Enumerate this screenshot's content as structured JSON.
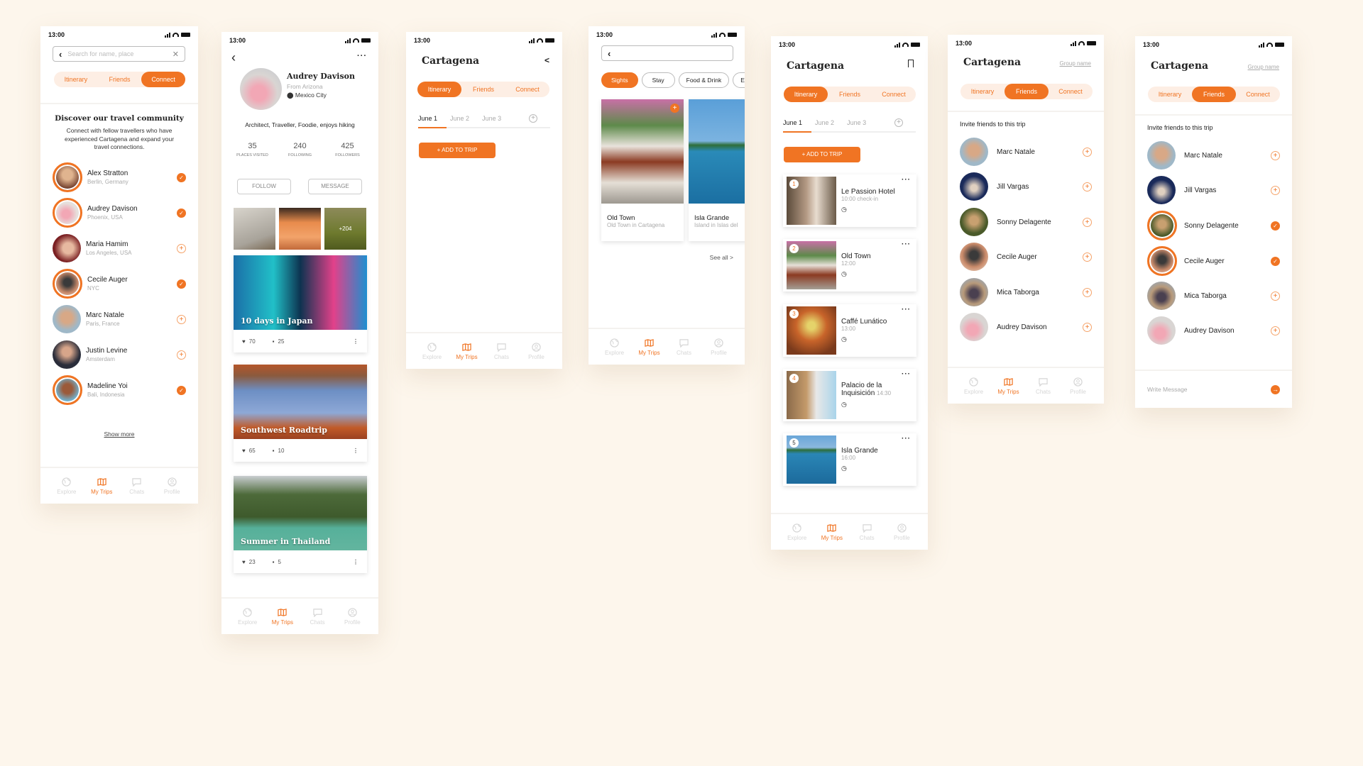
{
  "status": {
    "time": "13:00"
  },
  "colors": {
    "accent": "#f07423",
    "accent_light": "#fdeee4",
    "background": "#fdf6ec"
  },
  "nav": [
    {
      "label": "Explore",
      "icon": "globe-icon"
    },
    {
      "label": "My Trips",
      "icon": "map-icon",
      "active": true
    },
    {
      "label": "Chats",
      "icon": "chat-icon"
    },
    {
      "label": "Profile",
      "icon": "profile-icon"
    }
  ],
  "tabs": [
    "Itinerary",
    "Friends",
    "Connect"
  ],
  "connect": {
    "search_placeholder": "Search for name, place",
    "active_tab": "Connect",
    "heading": "Discover our travel community",
    "description": "Connect with fellow travellers who have experienced Cartagena and expand your travel connections.",
    "people": [
      {
        "name": "Alex Stratton",
        "location": "Berlin, Germany",
        "selected": true
      },
      {
        "name": "Audrey Davison",
        "location": "Phoenix, USA",
        "selected": true
      },
      {
        "name": "Maria Hamim",
        "location": "Los Angeles, USA",
        "selected": false
      },
      {
        "name": "Cecile Auger",
        "location": "NYC",
        "selected": true
      },
      {
        "name": "Marc Natale",
        "location": "Paris, France",
        "selected": false
      },
      {
        "name": "Justin Levine",
        "location": "Amsterdam",
        "selected": false
      },
      {
        "name": "Madeline Yoi",
        "location": "Bali, Indonesia",
        "selected": true
      }
    ],
    "show_more": "Show more"
  },
  "profile": {
    "name": "Audrey Davison",
    "from": "From Arizona",
    "city": "Mexico City",
    "bio": "Architect, Traveller, Foodie, enjoys hiking",
    "stats": [
      {
        "value": "35",
        "label": "PLACES VISITED"
      },
      {
        "value": "240",
        "label": "FOLLOWING"
      },
      {
        "value": "425",
        "label": "FOLLOWERS"
      }
    ],
    "follow": "FOLLOW",
    "message": "MESSAGE",
    "more_photos": "+204",
    "trips": [
      {
        "title": "10 days in Japan",
        "likes": "70",
        "comments": "25"
      },
      {
        "title": "Southwest Roadtrip",
        "likes": "65",
        "comments": "10"
      },
      {
        "title": "Summer in Thailand",
        "likes": "23",
        "comments": "5"
      }
    ]
  },
  "trip": {
    "title": "Cartagena",
    "dates": [
      "June 1",
      "June 2",
      "June 3"
    ],
    "add_button": "+ ADD TO TRIP",
    "items": [
      {
        "num": "1",
        "name": "Le Passion Hotel",
        "time": "10:00 check-in"
      },
      {
        "num": "2",
        "name": "Old Town",
        "time": "12:00"
      },
      {
        "num": "3",
        "name": "Caffé Lunático",
        "time": "13:00"
      },
      {
        "num": "4",
        "name": "Palacio de la Inquisición",
        "time": "14:30"
      },
      {
        "num": "5",
        "name": "Isla Grande",
        "time": "16:00"
      }
    ]
  },
  "explore": {
    "chips": [
      "Sights",
      "Stay",
      "Food & Drink",
      "E"
    ],
    "places": [
      {
        "name": "Old Town",
        "desc": "Old Town in Cartagena"
      },
      {
        "name": "Isla Grande",
        "desc": "Island in Islas del"
      }
    ],
    "see_all": "See all >"
  },
  "friends": {
    "group_name": "Group name",
    "invite": "Invite friends to this trip",
    "list": [
      "Marc Natale",
      "Jill Vargas",
      "Sonny Delagente",
      "Cecile Auger",
      "Mica Taborga",
      "Audrey Davison"
    ],
    "selected_in_second": [
      "Sonny Delagente",
      "Cecile Auger"
    ],
    "write_message_placeholder": "Write Message"
  }
}
